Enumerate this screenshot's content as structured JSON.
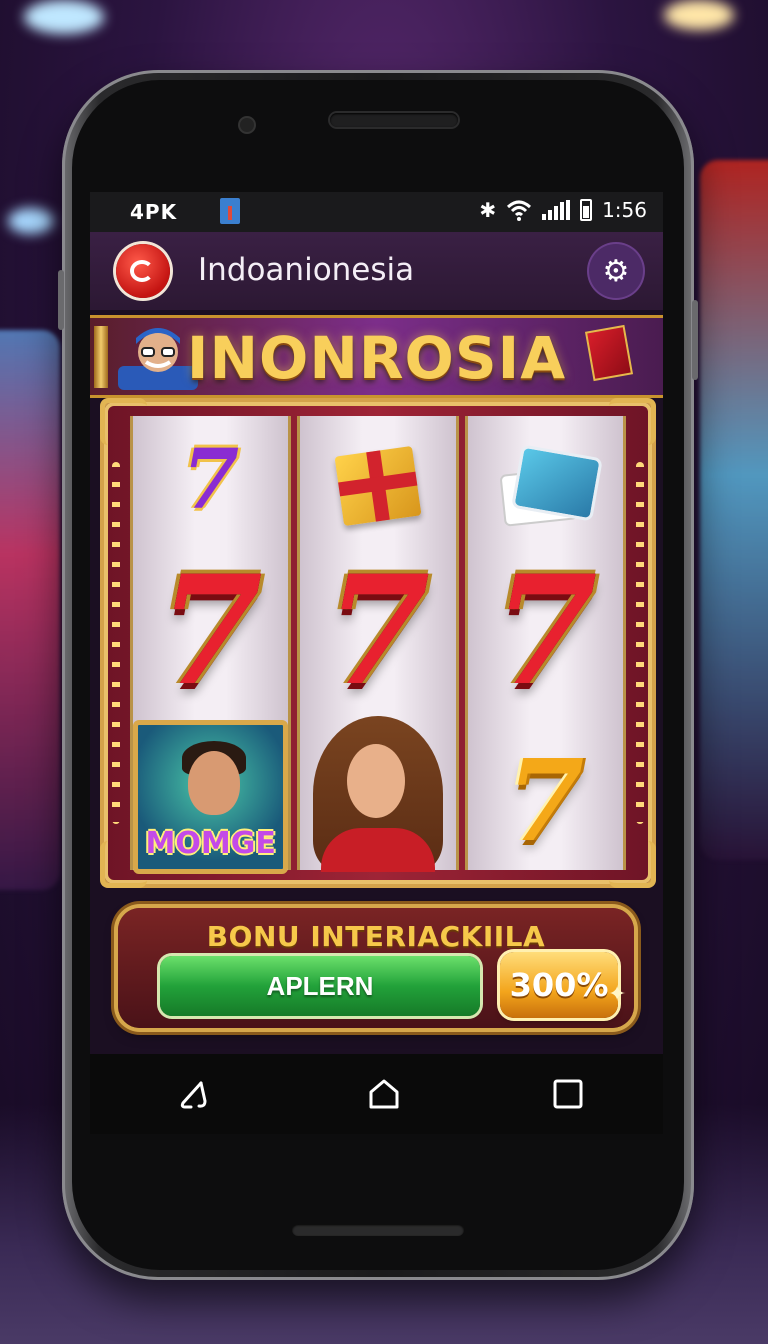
{
  "status_bar": {
    "left_text": "4PK",
    "time": "1:56",
    "icons": [
      "app-notification-icon",
      "brightness-icon",
      "wifi-icon",
      "signal-icon",
      "battery-icon"
    ]
  },
  "app_bar": {
    "title": "Indoanionesia",
    "logo_icon": "app-logo-icon",
    "settings_icon": "gear-icon"
  },
  "game": {
    "banner_title": "INONROSIA",
    "reels": [
      {
        "top": "purple-seven",
        "middle": "red-seven",
        "bottom": "character-card"
      },
      {
        "top": "gift-box",
        "middle": "red-seven",
        "bottom": "woman-portrait"
      },
      {
        "top": "playing-cards",
        "middle": "red-seven",
        "bottom": "gold-seven"
      }
    ],
    "symbol_text": {
      "seven": "7",
      "character_card_label": "MOMGE"
    }
  },
  "bonus": {
    "title": "BONU INTERIACKIILA",
    "apply_button": "APLERN",
    "percent_badge": "300%"
  },
  "nav_bar": {
    "back_icon": "back-icon",
    "home_icon": "home-icon",
    "recents_icon": "recents-icon"
  },
  "colors": {
    "accent_gold": "#d6a74b",
    "reel_red": "#e8212f",
    "button_green": "#22a23a",
    "app_bar_purple": "#3a2044"
  }
}
